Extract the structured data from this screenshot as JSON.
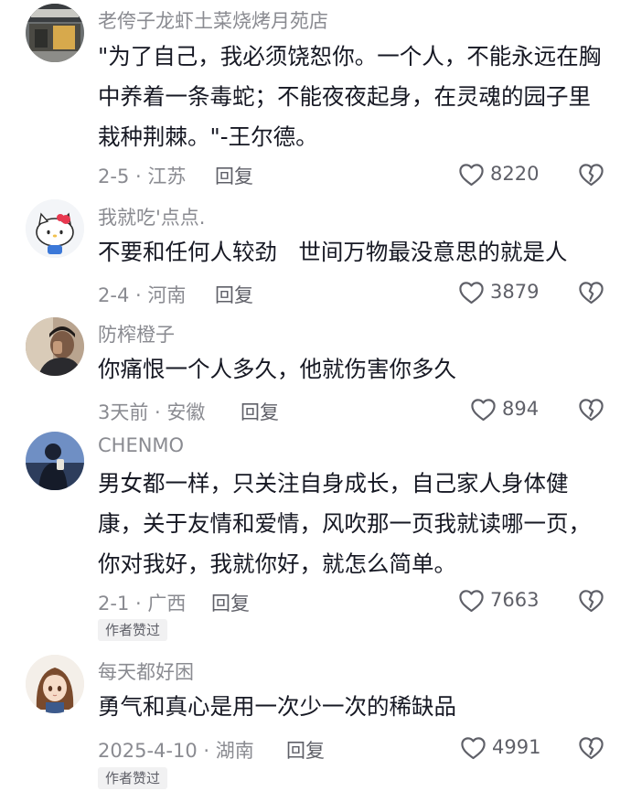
{
  "comments": [
    {
      "username": "老侉子龙虾土菜烧烤月苑店",
      "text": "\"为了自己，我必须饶恕你。一个人，不能永远在胸中养着一条毒蛇；不能夜夜起身，在灵魂的园子里栽种荆棘。\"-王尔德。",
      "date_location": "2-5 · 江苏",
      "reply_label": "回复",
      "likes": "8220",
      "avatar_icon": "storefront-photo-icon"
    },
    {
      "username": "我就吃'点点.",
      "text": "不要和任何人较劲   世间万物最没意思的就是人",
      "date_location": "2-4 · 河南",
      "reply_label": "回复",
      "likes": "3879",
      "avatar_icon": "hello-kitty-avatar-icon"
    },
    {
      "username": "防榨橙子",
      "text": "你痛恨一个人多久，他就伤害你多久",
      "date_location": "3天前 · 安徽",
      "reply_label": "回复",
      "likes": "894",
      "avatar_icon": "person-photo-icon"
    },
    {
      "username": "CHENMO",
      "text": "男女都一样，只关注自身成长，自己家人身体健康，关于友情和爱情，风吹那一页我就读哪一页，你对我好，我就你好，就怎么简单。",
      "date_location": "2-1 · 广西",
      "reply_label": "回复",
      "likes": "7663",
      "badge": "作者赞过",
      "avatar_icon": "night-silhouette-icon"
    },
    {
      "username": "每天都好困",
      "text": "勇气和真心是用一次少一次的稀缺品",
      "date_location": "2025-4-10 · 湖南",
      "reply_label": "回复",
      "likes": "4991",
      "badge": "作者赞过",
      "avatar_icon": "anime-girl-avatar-icon"
    }
  ],
  "colors": {
    "text_primary": "#161823",
    "text_secondary": "#8a8b91",
    "icon_gray": "#5f6068",
    "badge_bg": "#f1f1f2"
  }
}
